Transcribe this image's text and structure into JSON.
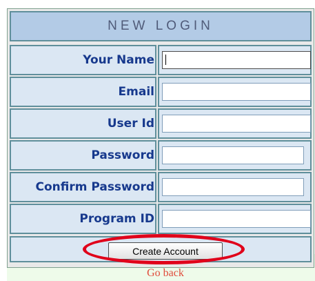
{
  "form": {
    "title": "NEW LOGIN",
    "fields": [
      {
        "label": "Your Name",
        "value": ""
      },
      {
        "label": "Email",
        "value": ""
      },
      {
        "label": "User Id",
        "value": ""
      },
      {
        "label": "Password",
        "value": ""
      },
      {
        "label": "Confirm Password",
        "value": ""
      },
      {
        "label": "Program ID",
        "value": ""
      }
    ],
    "submit_label": "Create Account",
    "back_link": "Go back"
  },
  "colors": {
    "header_bg": "#b3cbe6",
    "cell_bg": "#dbe7f3",
    "label_text": "#17398d",
    "link_text": "#e04b3a",
    "highlight": "#e0001a"
  }
}
